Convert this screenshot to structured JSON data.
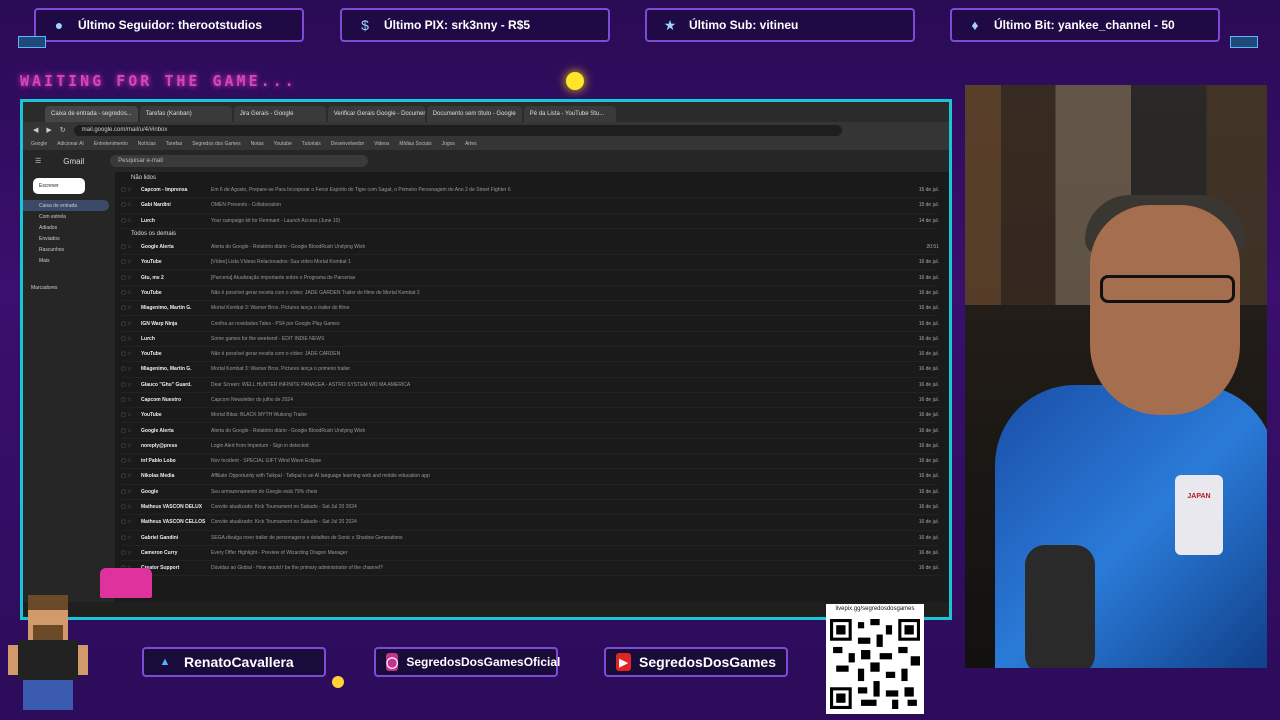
{
  "overlay": {
    "alerts": [
      {
        "icon": "user-icon",
        "text": "Último Seguidor: therootstudios"
      },
      {
        "icon": "dollar-icon",
        "text": "Último PIX: srk3nny - R$5"
      },
      {
        "icon": "star-icon",
        "text": "Último Sub: vitineu"
      },
      {
        "icon": "diamond-icon",
        "text": "Último Bit: yankee_channel - 50"
      }
    ],
    "status": "WAITING FOR THE GAME...",
    "socials": [
      {
        "icon": "twitter-icon",
        "text": "RenatoCavallera"
      },
      {
        "icon": "instagram-icon",
        "text": "SegredosDosGamesOficial"
      },
      {
        "icon": "youtube-icon",
        "text": "SegredosDosGames"
      }
    ],
    "qr_url": "livepix.gg/segredosdosgames",
    "webcam_shirt_text": "JAPAN"
  },
  "browser": {
    "tabs": [
      "Caixa de entrada - segredos...",
      "Tarefas (Kanban)",
      "Jira Gerais - Google",
      "Verificar Gerais Google - Documen...",
      "Documento sem título - Google",
      "Pé da Lista - YouTube Stu..."
    ],
    "url": "mail.google.com/mail/u/4/#inbox",
    "bookmarks": [
      "Google",
      "Adicionar AI",
      "Entretenimento",
      "Notícias",
      "Tarefas",
      "Segredos dos Games",
      "Notas",
      "Youtube",
      "Tutoriais",
      "Desenvolvedor",
      "Videos",
      "Mídias Sociais",
      "Jogos",
      "Artes"
    ],
    "gmail": {
      "logo": "Gmail",
      "search_placeholder": "Pesquisar e-mail",
      "compose": "Escrever",
      "sidebar": [
        "Caixa de entrada",
        "Com estrela",
        "Adiados",
        "Enviados",
        "Rascunhos",
        "Mais",
        "Marcadores"
      ],
      "section_unread": "Não lidos",
      "section_all": "Todos os demais",
      "rows": [
        {
          "from": "Capcom - Imprensa",
          "subject": "Em 6 de Agosto, Prepare-se Para Incorporar o Feroz Espírito do Tigre com Sagat, o Primeiro Personagem do Ano 2 de Street Fighter 6",
          "date": "15 de jul."
        },
        {
          "from": "Gabi Nardini",
          "subject": "OMEN Presents - Collaboration",
          "date": "15 de jul."
        },
        {
          "from": "Lurch",
          "subject": "Your campaign kit for Remnant - Launch Access (June 10)",
          "date": "14 de jul."
        },
        {
          "from": "Google Alerta",
          "subject": "Alerta do Google - Relatório diário - Google BloodRush Undying Wish",
          "date": "20:51"
        },
        {
          "from": "YouTube",
          "subject": "[Vídeo] Lista Vídeos Relacionados: Sua vídeo Mortal Kombat 1",
          "date": "16 de jul."
        },
        {
          "from": "Gtu, me 2",
          "subject": "[Parceria] Atualização importante sobre o Programa de Parcerias",
          "date": "16 de jul."
        },
        {
          "from": "YouTube",
          "subject": "Não é possível gerar receita com o vídeo: JADE GARDEN Trailer do filme de Mortal Kombat 2",
          "date": "16 de jul."
        },
        {
          "from": "Miagenimo, Martin G.",
          "subject": "Mortal Kombat 3: Warner Bros. Pictures lança o trailer do filme",
          "date": "16 de jul."
        },
        {
          "from": "IGN Warp Ninja",
          "subject": "Confira as novidades Tales - PS4 por Google Play Games",
          "date": "16 de jul."
        },
        {
          "from": "Lurch",
          "subject": "Some games for the weekend - EDIT INDIE NEWS",
          "date": "16 de jul."
        },
        {
          "from": "YouTube",
          "subject": "Não é possível gerar receita com o vídeo: JADE CARDEN",
          "date": "16 de jul."
        },
        {
          "from": "Miagenimo, Martin G.",
          "subject": "Mortal Kombat 3: Warner Bros. Pictures lança o primeiro trailer",
          "date": "16 de jul."
        },
        {
          "from": "Glauco \"Ghu\" Guard.",
          "subject": "Dear Screen: WELL HUNTER INFINITE PANACEA - ASTRO SYSTEM WO MA AMERICA",
          "date": "16 de jul."
        },
        {
          "from": "Capcom Nuestro",
          "subject": "Capcom Newsletter do julho de 2024",
          "date": "16 de jul."
        },
        {
          "from": "YouTube",
          "subject": "Mortal Bitas: BLACK MYTH Wukong Trailer",
          "date": "16 de jul."
        },
        {
          "from": "Google Alerta",
          "subject": "Alerta do Google - Relatório diário - Google BloodRush Undying Wish",
          "date": "16 de jul."
        },
        {
          "from": "noreply@press",
          "subject": "Login Alert from Imperium - Sign in detected",
          "date": "16 de jul."
        },
        {
          "from": "inf Pablo Lobo",
          "subject": "Nov Incident - SPECIAL GIFT Wind Wave Eclipse",
          "date": "16 de jul."
        },
        {
          "from": "Nikolas Media",
          "subject": "Affiliate Opportunity with Talkpal - Talkpal is an AI language learning web and mobile education app",
          "date": "16 de jul."
        },
        {
          "from": "Google",
          "subject": "Seu armazenamento do Google está 79% cheio",
          "date": "16 de jul."
        },
        {
          "from": "Matheus VASCON DELUX",
          "subject": "Convite atualizado: Kick Tournament no Sabado - Sat Jul 20 2024",
          "date": "16 de jul."
        },
        {
          "from": "Matheus VASCON CELLOS",
          "subject": "Convite atualizado: Kick Tournament no Sabado - Sat Jul 20 2024",
          "date": "16 de jul."
        },
        {
          "from": "Gabriel Gandini",
          "subject": "SEGA divulga novo trailer de personagens e detalhes de Sonic x Shadow Generations",
          "date": "16 de jul."
        },
        {
          "from": "Cameron Curry",
          "subject": "Every Offer Highlight - Preview of Wizarding Dragon Manager",
          "date": "16 de jul."
        },
        {
          "from": "Creator Support",
          "subject": "Dúvidas ao Global - How would I be the primary administrator of the channel?",
          "date": "16 de jul."
        }
      ]
    }
  }
}
